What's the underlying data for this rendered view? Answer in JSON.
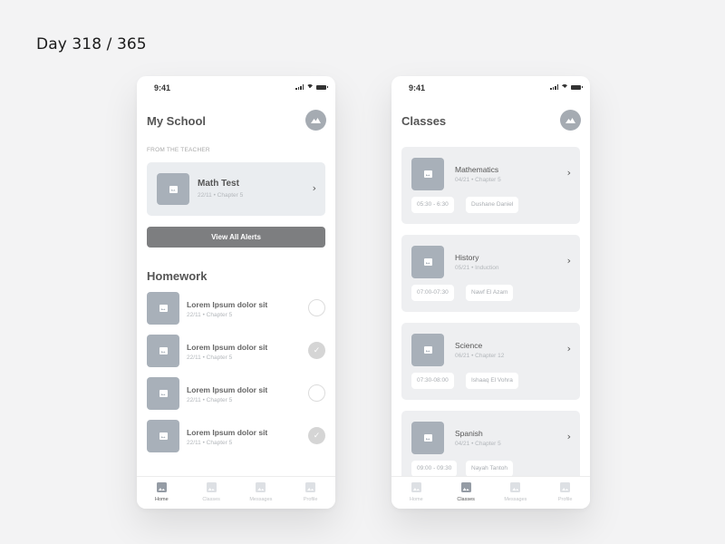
{
  "page": {
    "day_label": "Day 318 / 365"
  },
  "colors": {
    "background": "#f3f3f4",
    "card": "#eaedf0",
    "thumb": "#a8b0b9",
    "button": "#7d7e80",
    "text": "#555555"
  },
  "left_screen": {
    "status": {
      "time": "9:41"
    },
    "header": {
      "title": "My School",
      "avatar_icon": "mountain-image-icon"
    },
    "teacher_section": {
      "caption": "FROM THE TEACHER",
      "alert": {
        "title": "Math Test",
        "subtitle": "22/11  •  Chapter 5",
        "icon": "chevron-right-icon",
        "chevron": "›"
      },
      "view_all_label": "View All Alerts"
    },
    "homework": {
      "title": "Homework",
      "items": [
        {
          "title": "Lorem Ipsum dolor sit",
          "subtitle": "22/11  •  Chapter 5",
          "done": false
        },
        {
          "title": "Lorem Ipsum dolor sit",
          "subtitle": "22/11  •  Chapter 5",
          "done": true
        },
        {
          "title": "Lorem Ipsum dolor sit",
          "subtitle": "22/11  •  Chapter 5",
          "done": false
        },
        {
          "title": "Lorem Ipsum dolor sit",
          "subtitle": "22/11  •  Chapter 5",
          "done": true
        }
      ],
      "check_glyph": "✓"
    },
    "tabs": [
      {
        "label": "Home",
        "active": true
      },
      {
        "label": "Classes",
        "active": false
      },
      {
        "label": "Messages",
        "active": false
      },
      {
        "label": "Profile",
        "active": false
      }
    ]
  },
  "right_screen": {
    "status": {
      "time": "9:41"
    },
    "header": {
      "title": "Classes",
      "avatar_icon": "mountain-image-icon"
    },
    "classes": [
      {
        "title": "Mathematics",
        "subtitle": "04/21  •  Chapter 5",
        "time": "05:30 - 6:30",
        "teacher": "Dushane Daniel",
        "chevron": "›"
      },
      {
        "title": "History",
        "subtitle": "05/21  •  Induction",
        "time": "07:00-07:30",
        "teacher": "Nawf El Azam",
        "chevron": "›"
      },
      {
        "title": "Science",
        "subtitle": "06/21  •  Chapter 12",
        "time": "07:30-08:00",
        "teacher": "Ishaaq El Vohra",
        "chevron": "›"
      },
      {
        "title": "Spanish",
        "subtitle": "04/21  •  Chapter 5",
        "time": "09:00 - 09:30",
        "teacher": "Nayah Tantoh",
        "chevron": "›"
      }
    ],
    "tabs": [
      {
        "label": "Home",
        "active": false
      },
      {
        "label": "Classes",
        "active": true
      },
      {
        "label": "Messages",
        "active": false
      },
      {
        "label": "Profile",
        "active": false
      }
    ]
  }
}
